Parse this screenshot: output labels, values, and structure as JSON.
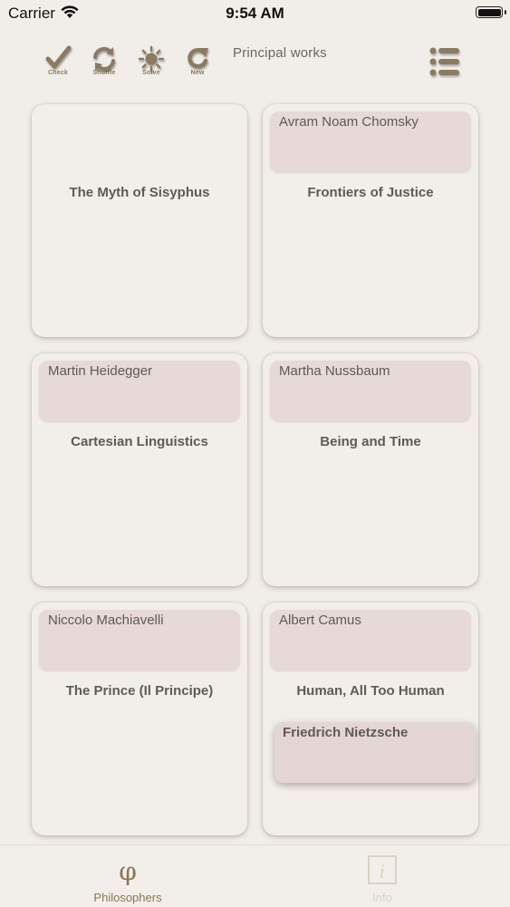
{
  "status_bar": {
    "carrier": "Carrier",
    "time": "9:54 AM"
  },
  "toolbar": {
    "title": "Principal works",
    "buttons": [
      {
        "label": "Check",
        "icon": "check-icon"
      },
      {
        "label": "Shuffle",
        "icon": "shuffle-icon"
      },
      {
        "label": "Solve",
        "icon": "sun-icon"
      },
      {
        "label": "New",
        "icon": "refresh-icon"
      }
    ],
    "menu_icon": "list-icon"
  },
  "cards": [
    {
      "work": "The Myth of Sisyphus",
      "philosopher": ""
    },
    {
      "work": "Frontiers of Justice",
      "philosopher": "Avram Noam Chomsky"
    },
    {
      "work": "Cartesian Linguistics",
      "philosopher": "Martin Heidegger"
    },
    {
      "work": "Being and Time",
      "philosopher": "Martha Nussbaum"
    },
    {
      "work": "The Prince (Il Principe)",
      "philosopher": "Niccolo Machiavelli"
    },
    {
      "work": "Human, All Too Human",
      "philosopher": "Albert Camus"
    }
  ],
  "floating_tag": {
    "philosopher": "Friedrich Nietzsche"
  },
  "tabbar": {
    "tabs": [
      {
        "label": "Philosophers",
        "icon": "phi-icon",
        "selected": true
      },
      {
        "label": "Info",
        "icon": "info-icon",
        "selected": false
      }
    ]
  },
  "colors": {
    "background": "#f1eee9",
    "tag": "#e7d9d8",
    "accent": "#8c7550",
    "text": "#5e5a55"
  }
}
